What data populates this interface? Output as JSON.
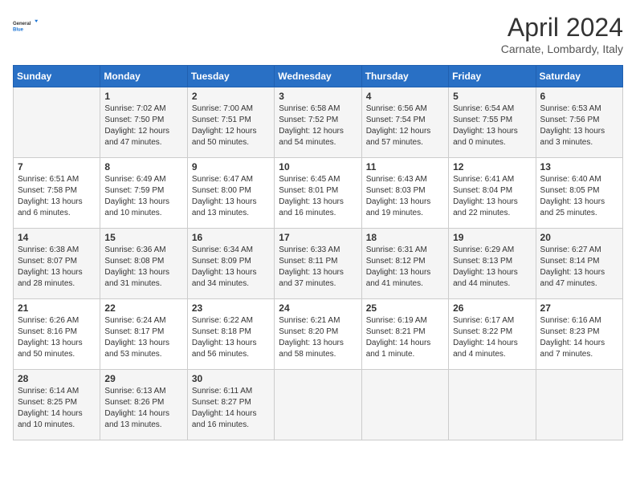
{
  "logo": {
    "line1": "General",
    "line2": "Blue"
  },
  "title": "April 2024",
  "location": "Carnate, Lombardy, Italy",
  "headers": [
    "Sunday",
    "Monday",
    "Tuesday",
    "Wednesday",
    "Thursday",
    "Friday",
    "Saturday"
  ],
  "weeks": [
    [
      {
        "day": "",
        "info": ""
      },
      {
        "day": "1",
        "info": "Sunrise: 7:02 AM\nSunset: 7:50 PM\nDaylight: 12 hours\nand 47 minutes."
      },
      {
        "day": "2",
        "info": "Sunrise: 7:00 AM\nSunset: 7:51 PM\nDaylight: 12 hours\nand 50 minutes."
      },
      {
        "day": "3",
        "info": "Sunrise: 6:58 AM\nSunset: 7:52 PM\nDaylight: 12 hours\nand 54 minutes."
      },
      {
        "day": "4",
        "info": "Sunrise: 6:56 AM\nSunset: 7:54 PM\nDaylight: 12 hours\nand 57 minutes."
      },
      {
        "day": "5",
        "info": "Sunrise: 6:54 AM\nSunset: 7:55 PM\nDaylight: 13 hours\nand 0 minutes."
      },
      {
        "day": "6",
        "info": "Sunrise: 6:53 AM\nSunset: 7:56 PM\nDaylight: 13 hours\nand 3 minutes."
      }
    ],
    [
      {
        "day": "7",
        "info": "Sunrise: 6:51 AM\nSunset: 7:58 PM\nDaylight: 13 hours\nand 6 minutes."
      },
      {
        "day": "8",
        "info": "Sunrise: 6:49 AM\nSunset: 7:59 PM\nDaylight: 13 hours\nand 10 minutes."
      },
      {
        "day": "9",
        "info": "Sunrise: 6:47 AM\nSunset: 8:00 PM\nDaylight: 13 hours\nand 13 minutes."
      },
      {
        "day": "10",
        "info": "Sunrise: 6:45 AM\nSunset: 8:01 PM\nDaylight: 13 hours\nand 16 minutes."
      },
      {
        "day": "11",
        "info": "Sunrise: 6:43 AM\nSunset: 8:03 PM\nDaylight: 13 hours\nand 19 minutes."
      },
      {
        "day": "12",
        "info": "Sunrise: 6:41 AM\nSunset: 8:04 PM\nDaylight: 13 hours\nand 22 minutes."
      },
      {
        "day": "13",
        "info": "Sunrise: 6:40 AM\nSunset: 8:05 PM\nDaylight: 13 hours\nand 25 minutes."
      }
    ],
    [
      {
        "day": "14",
        "info": "Sunrise: 6:38 AM\nSunset: 8:07 PM\nDaylight: 13 hours\nand 28 minutes."
      },
      {
        "day": "15",
        "info": "Sunrise: 6:36 AM\nSunset: 8:08 PM\nDaylight: 13 hours\nand 31 minutes."
      },
      {
        "day": "16",
        "info": "Sunrise: 6:34 AM\nSunset: 8:09 PM\nDaylight: 13 hours\nand 34 minutes."
      },
      {
        "day": "17",
        "info": "Sunrise: 6:33 AM\nSunset: 8:11 PM\nDaylight: 13 hours\nand 37 minutes."
      },
      {
        "day": "18",
        "info": "Sunrise: 6:31 AM\nSunset: 8:12 PM\nDaylight: 13 hours\nand 41 minutes."
      },
      {
        "day": "19",
        "info": "Sunrise: 6:29 AM\nSunset: 8:13 PM\nDaylight: 13 hours\nand 44 minutes."
      },
      {
        "day": "20",
        "info": "Sunrise: 6:27 AM\nSunset: 8:14 PM\nDaylight: 13 hours\nand 47 minutes."
      }
    ],
    [
      {
        "day": "21",
        "info": "Sunrise: 6:26 AM\nSunset: 8:16 PM\nDaylight: 13 hours\nand 50 minutes."
      },
      {
        "day": "22",
        "info": "Sunrise: 6:24 AM\nSunset: 8:17 PM\nDaylight: 13 hours\nand 53 minutes."
      },
      {
        "day": "23",
        "info": "Sunrise: 6:22 AM\nSunset: 8:18 PM\nDaylight: 13 hours\nand 56 minutes."
      },
      {
        "day": "24",
        "info": "Sunrise: 6:21 AM\nSunset: 8:20 PM\nDaylight: 13 hours\nand 58 minutes."
      },
      {
        "day": "25",
        "info": "Sunrise: 6:19 AM\nSunset: 8:21 PM\nDaylight: 14 hours\nand 1 minute."
      },
      {
        "day": "26",
        "info": "Sunrise: 6:17 AM\nSunset: 8:22 PM\nDaylight: 14 hours\nand 4 minutes."
      },
      {
        "day": "27",
        "info": "Sunrise: 6:16 AM\nSunset: 8:23 PM\nDaylight: 14 hours\nand 7 minutes."
      }
    ],
    [
      {
        "day": "28",
        "info": "Sunrise: 6:14 AM\nSunset: 8:25 PM\nDaylight: 14 hours\nand 10 minutes."
      },
      {
        "day": "29",
        "info": "Sunrise: 6:13 AM\nSunset: 8:26 PM\nDaylight: 14 hours\nand 13 minutes."
      },
      {
        "day": "30",
        "info": "Sunrise: 6:11 AM\nSunset: 8:27 PM\nDaylight: 14 hours\nand 16 minutes."
      },
      {
        "day": "",
        "info": ""
      },
      {
        "day": "",
        "info": ""
      },
      {
        "day": "",
        "info": ""
      },
      {
        "day": "",
        "info": ""
      }
    ]
  ]
}
